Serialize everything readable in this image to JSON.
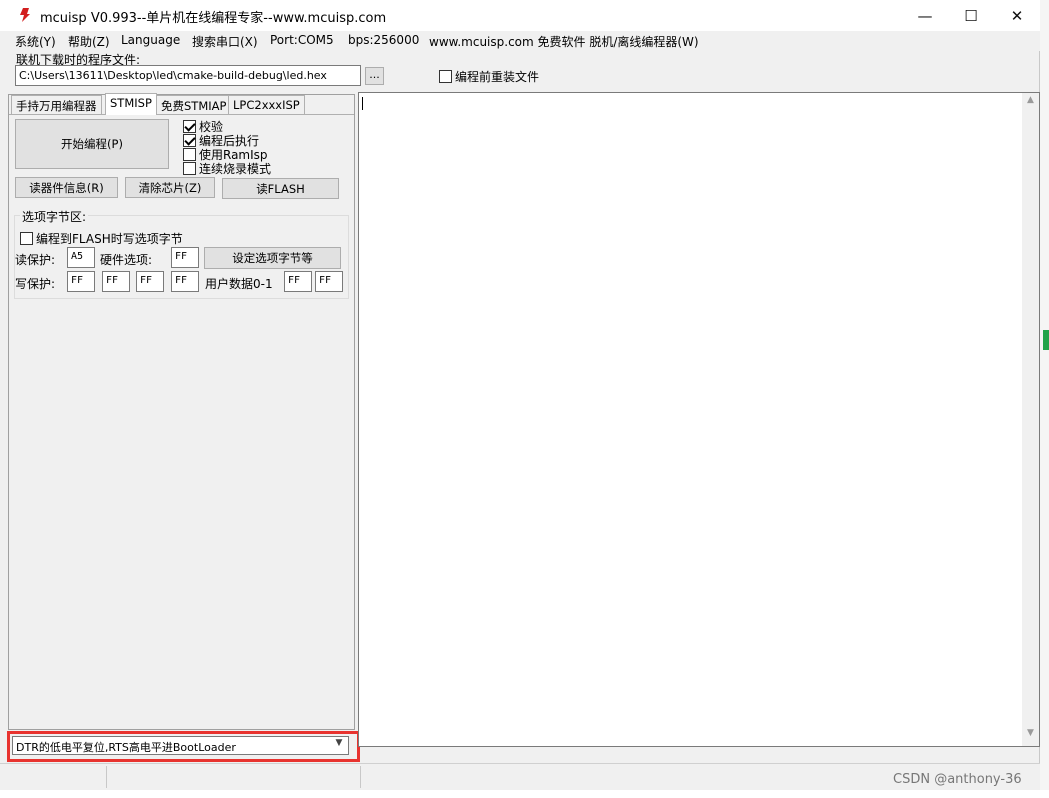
{
  "window": {
    "title": "mcuisp V0.993--单片机在线编程专家--www.mcuisp.com",
    "minimize": "—",
    "maximize": "☐",
    "close": "✕"
  },
  "menu": {
    "items": [
      "系统(Y)",
      "帮助(Z)",
      "Language",
      "搜索串口(X)",
      "Port:COM5",
      "bps:256000",
      "www.mcuisp.com 免费软件 脱机/离线编程器(W)"
    ]
  },
  "file": {
    "label": "联机下载时的程序文件:",
    "path": "C:\\Users\\13611\\Desktop\\led\\cmake-build-debug\\led.hex",
    "browse": "...",
    "reload_label": "编程前重装文件",
    "reload_checked": false
  },
  "tabs": [
    "手持万用编程器",
    "STMISP",
    "免费STMIAP",
    "LPC2xxxISP"
  ],
  "active_tab": "STMISP",
  "stmisp": {
    "start_program": "开始编程(P)",
    "options": [
      {
        "label": "校验",
        "checked": true
      },
      {
        "label": "编程后执行",
        "checked": true
      },
      {
        "label": "使用RamIsp",
        "checked": false
      },
      {
        "label": "连续烧录模式",
        "checked": false
      }
    ],
    "read_device_info": "读器件信息(R)",
    "erase_chip": "清除芯片(Z)",
    "read_flash": "读FLASH"
  },
  "option_bytes": {
    "title": "选项字节区:",
    "write_on_flash_label": "编程到FLASH时写选项字节",
    "write_on_flash_checked": false,
    "read_protect_label": "读保护:",
    "read_protect_value": "A5",
    "hw_option_label": "硬件选项:",
    "hw_option_value": "FF",
    "set_button": "设定选项字节等",
    "write_protect_label": "写保护:",
    "write_protect_values": [
      "FF",
      "FF",
      "FF",
      "FF"
    ],
    "user_data_label": "用户数据0-1",
    "user_data_values": [
      "FF",
      "FF"
    ]
  },
  "boot_mode": {
    "selected": "DTR的低电平复位,RTS高电平进BootLoader"
  },
  "watermark": "CSDN @anthony-36",
  "colors": {
    "highlight_outline": "#e8332f",
    "window_bg": "#f0f0f0",
    "output_bg": "#ffffff"
  }
}
